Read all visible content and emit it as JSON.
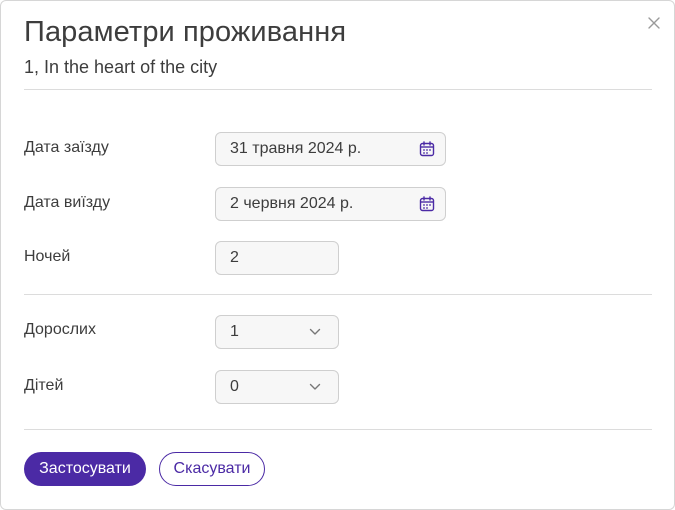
{
  "dialog": {
    "title": "Параметри проживання",
    "subtitle": "1, In the heart of the city",
    "close_icon": "close-icon"
  },
  "dates": {
    "checkin_label": "Дата заїзду",
    "checkin_value": "31 травня 2024 р.",
    "checkout_label": "Дата виїзду",
    "checkout_value": "2 червня 2024 р.",
    "nights_label": "Ночей",
    "nights_value": "2",
    "calendar_icon": "calendar-icon"
  },
  "guests": {
    "adults_label": "Дорослих",
    "adults_value": "1",
    "children_label": "Дітей",
    "children_value": "0",
    "dropdown_icon": "chevron-down-icon"
  },
  "actions": {
    "apply_label": "Застосувати",
    "cancel_label": "Скасувати"
  },
  "colors": {
    "accent": "#4b2aa5",
    "field_bg": "#f7f7f7",
    "border": "#cfcfcf",
    "divider": "#dcdcdc",
    "text": "#3d3d3d"
  }
}
